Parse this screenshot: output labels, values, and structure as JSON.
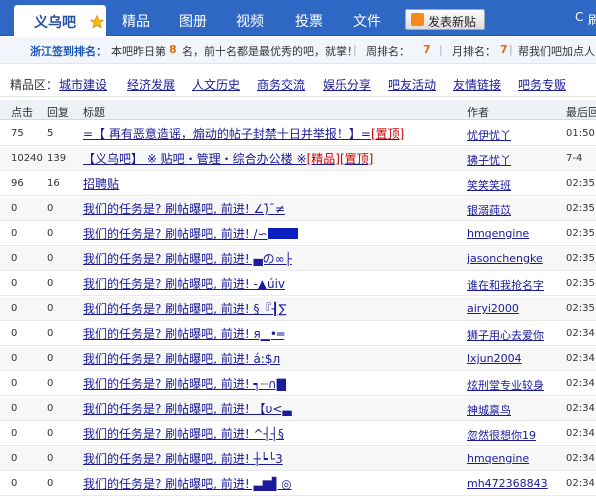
{
  "nav": {
    "active_tab": "义乌吧",
    "tabs": [
      "精品",
      "图册",
      "视频",
      "投票",
      "文件"
    ],
    "post_button": "发表新贴",
    "refresh_label": "刷"
  },
  "signin": {
    "title": "浙江签到排名：",
    "text1": "本吧昨日第",
    "rank": "8",
    "text2": "名，前十名都是最优秀的吧，就掌！",
    "week_label": "周排名：",
    "week_rank": "7",
    "month_label": "月排名：",
    "month_rank": "7",
    "tail": "帮我们吧加点人"
  },
  "categories": {
    "label": "精品区：",
    "items": [
      "城市建设",
      "经济发展",
      "人文历史",
      "商务交流",
      "娱乐分享",
      "吧友活动",
      "友情链接",
      "吧务专贩"
    ]
  },
  "table": {
    "headers": {
      "clicks": "点击",
      "replies": "回复",
      "title": "标题",
      "author": "作者",
      "last": "最后回"
    },
    "rows": [
      {
        "clicks": "75",
        "replies": "5",
        "title": "=【 再有恶意造谣，煽动的帖子封禁十日并举报！】=",
        "tag": "[置顶]",
        "author": "忧伊忧丫",
        "time": "01:50"
      },
      {
        "clicks": "10240",
        "replies": "139",
        "title": "【义乌吧】              ※ 贴吧・管理・综合办公楼 ※",
        "tag": "[精品]",
        "tag2": "[置顶]",
        "author": "狒子忧丫",
        "time": "7-4"
      },
      {
        "clicks": "96",
        "replies": "16",
        "title": "招聘贴",
        "author": "笑笑笑班",
        "time": "02:35"
      },
      {
        "clicks": "0",
        "replies": "0",
        "title": "我们的任务是? 刷帖曝吧, 前进! ∠)̄¯≠",
        "author": "银溺莼苡",
        "time": "02:35"
      },
      {
        "clicks": "0",
        "replies": "0",
        "title": "我们的任务是? 刷帖曝吧, 前进! /∽",
        "blk": 30,
        "author": "hmqengine",
        "time": "02:35"
      },
      {
        "clicks": "0",
        "replies": "0",
        "title": "我们的任务是? 刷帖曝吧, 前进! ▄の∞├",
        "author": "jasonchengke",
        "time": "02:35"
      },
      {
        "clicks": "0",
        "replies": "0",
        "title": "我们的任务是? 刷帖曝吧, 前进! -▲úiv",
        "author": "谁在和我抢名字",
        "time": "02:35"
      },
      {
        "clicks": "0",
        "replies": "0",
        "title": "我们的任务是? 刷帖曝吧, 前进! §『┨∑",
        "author": "airyi2000",
        "time": "02:35"
      },
      {
        "clicks": "0",
        "replies": "0",
        "title": "我们的任务是? 刷帖曝吧, 前进! я▁•═",
        "author": "狮子用心去爱你",
        "time": "02:34"
      },
      {
        "clicks": "0",
        "replies": "0",
        "title": "我们的任务是? 刷帖曝吧, 前进! á:$л",
        "author": "lxjun2004",
        "time": "02:34"
      },
      {
        "clicks": "0",
        "replies": "0",
        "title": "我们的任务是? 刷帖曝吧, 前进! ┑┈∩▇",
        "author": "炫刑堂专业较身",
        "time": "02:34"
      },
      {
        "clicks": "0",
        "replies": "0",
        "title": "我们的任务是? 刷帖曝吧, 前进! 【υ<▃",
        "author": "神城禀鸟",
        "time": "02:34"
      },
      {
        "clicks": "0",
        "replies": "0",
        "title": "我们的任务是? 刷帖曝吧, 前进! ^┤┤§",
        "author": "忽然很想你19",
        "time": "02:34"
      },
      {
        "clicks": "0",
        "replies": "0",
        "title": "我们的任务是? 刷帖曝吧, 前进! ┼┕└3",
        "author": "hmqengine",
        "time": "02:34"
      },
      {
        "clicks": "0",
        "replies": "0",
        "title": "我们的任务是? 刷帖曝吧, 前进! ▃▆▌◎",
        "author": "mh472368843",
        "time": "02:34"
      }
    ]
  }
}
